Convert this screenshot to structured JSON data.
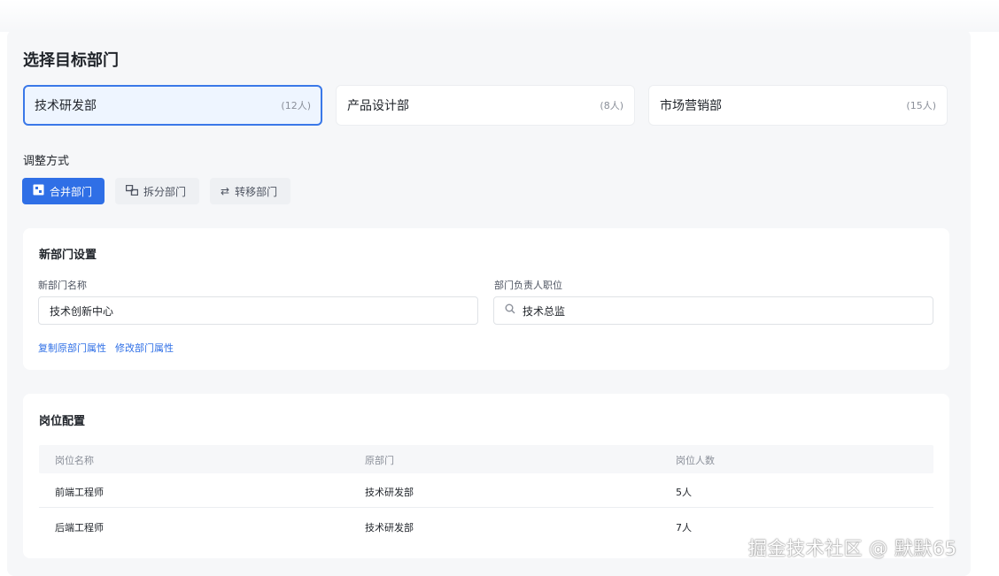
{
  "page": {
    "title": "选择目标部门"
  },
  "departments": [
    {
      "name": "技术研发部",
      "count": "(12人)",
      "selected": true
    },
    {
      "name": "产品设计部",
      "count": "(8人)",
      "selected": false
    },
    {
      "name": "市场营销部",
      "count": "(15人)",
      "selected": false
    }
  ],
  "adjust": {
    "label": "调整方式",
    "modes": [
      {
        "label": "合并部门",
        "icon": "merge-icon",
        "active": true
      },
      {
        "label": "拆分部门",
        "icon": "split-icon",
        "active": false
      },
      {
        "label": "转移部门",
        "icon": "transfer-icon",
        "active": false
      }
    ]
  },
  "new_dept": {
    "title": "新部门设置",
    "name_label": "新部门名称",
    "name_value": "技术创新中心",
    "leader_label": "部门负责人职位",
    "leader_value": "技术总监",
    "links": [
      "复制原部门属性",
      "修改部门属性"
    ]
  },
  "positions": {
    "title": "岗位配置",
    "columns": [
      "岗位名称",
      "原部门",
      "岗位人数"
    ],
    "rows": [
      [
        "前端工程师",
        "技术研发部",
        "5人"
      ],
      [
        "后端工程师",
        "技术研发部",
        "7人"
      ]
    ]
  },
  "watermark": "掘金技术社区 @ 默默65",
  "colors": {
    "accent": "#2f6fe6",
    "selected_border": "#3a78e8",
    "selected_bg": "#eef5ff"
  }
}
